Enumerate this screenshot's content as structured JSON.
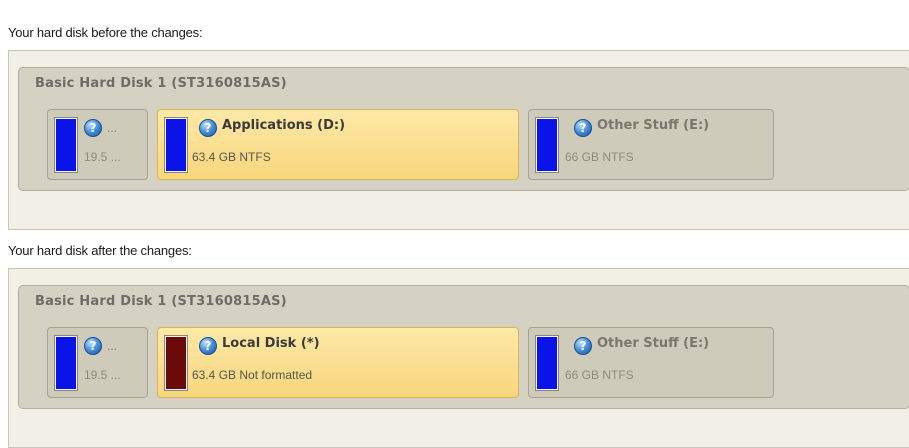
{
  "before": {
    "heading": "Your hard disk before the changes:",
    "disk_title": "Basic Hard Disk 1 (ST3160815AS)",
    "partitions": [
      {
        "name": "...",
        "info": "19.5 ...",
        "color": "#0a14e8",
        "selected": false
      },
      {
        "name": "Applications (D:)",
        "info": "63.4 GB NTFS",
        "color": "#0a14e8",
        "selected": true
      },
      {
        "name": "Other Stuff (E:)",
        "info": "66 GB NTFS",
        "color": "#0a14e8",
        "selected": false
      }
    ]
  },
  "after": {
    "heading": "Your hard disk after the changes:",
    "disk_title": "Basic Hard Disk 1 (ST3160815AS)",
    "partitions": [
      {
        "name": "...",
        "info": "19.5 ...",
        "color": "#0a14e8",
        "selected": false
      },
      {
        "name": "Local Disk (*)",
        "info": "63.4 GB Not formatted",
        "color": "#6a0a0a",
        "selected": true
      },
      {
        "name": "Other Stuff (E:)",
        "info": "66 GB NTFS",
        "color": "#0a14e8",
        "selected": false
      }
    ]
  },
  "icons": {
    "partition_info": "question-mark-icon"
  }
}
